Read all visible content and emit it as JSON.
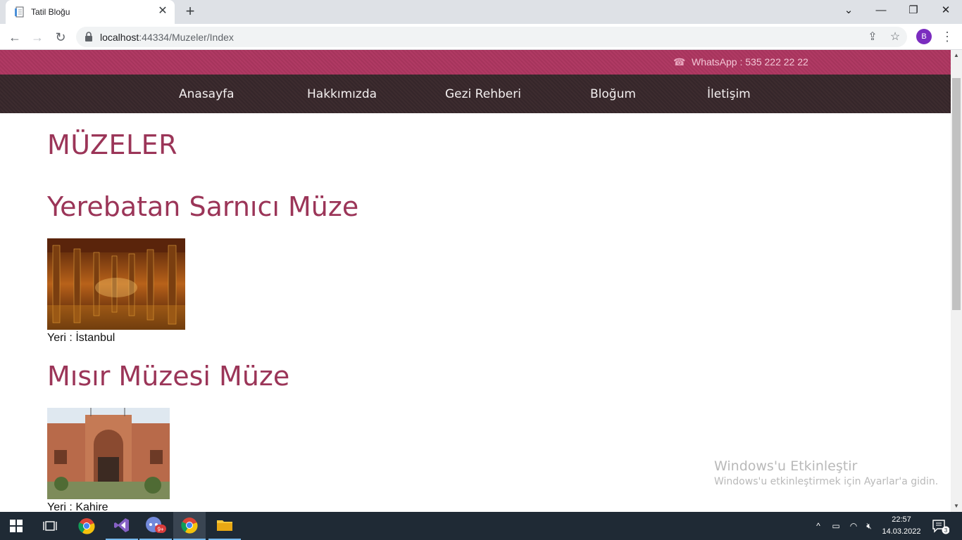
{
  "browser": {
    "tab_title": "Tatil Bloğu",
    "url_host": "localhost",
    "url_rest": ":44334/Muzeler/Index",
    "profile_initial": "B",
    "accent_color": "#7b2cbf"
  },
  "site": {
    "phone_text": "WhatsApp : 535 222 22 22",
    "menu": [
      {
        "label": "Anasayfa"
      },
      {
        "label": "Hakkımızda"
      },
      {
        "label": "Gezi Rehberi"
      },
      {
        "label": "Bloğum"
      },
      {
        "label": "İletişim"
      }
    ],
    "brand_color": "#9b3558",
    "page_title": "MÜZELER",
    "museums": [
      {
        "title": "Yerebatan Sarnıcı Müze",
        "location": "Yeri : İstanbul"
      },
      {
        "title": "Mısır Müzesi Müze",
        "location": "Yeri : Kahire"
      }
    ]
  },
  "watermark": {
    "line1": "Windows'u Etkinleştir",
    "line2": "Windows'u etkinleştirmek için Ayarlar'a gidin."
  },
  "taskbar": {
    "time": "22:57",
    "date": "14.03.2022",
    "notification_count": "3",
    "discord_badge": "9+"
  }
}
